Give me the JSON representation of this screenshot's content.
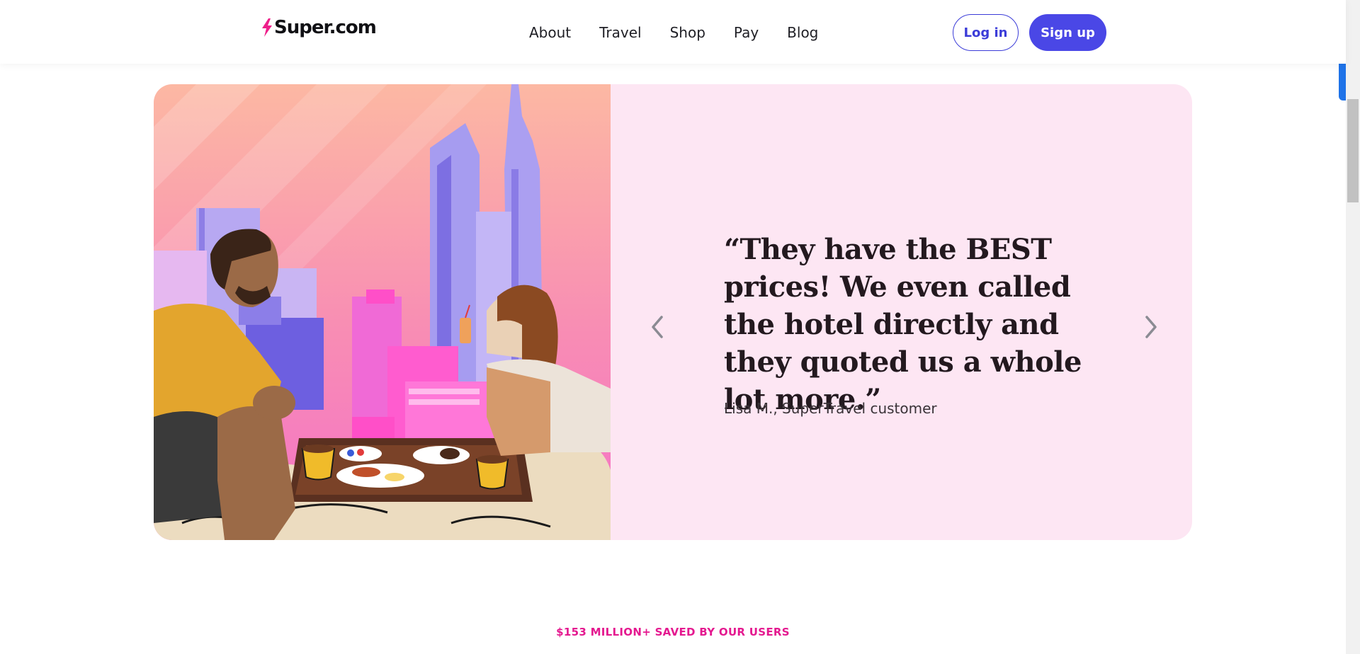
{
  "header": {
    "logo_text": "Super.com",
    "nav": [
      "About",
      "Travel",
      "Shop",
      "Pay",
      "Blog"
    ],
    "login_label": "Log in",
    "signup_label": "Sign up"
  },
  "testimonial": {
    "quote": "“They have the BEST prices! We even called the hotel directly and they quoted us a whole lot more.”",
    "author": "Lisa M., SuperTravel customer",
    "prev_icon": "chevron-left-icon",
    "next_icon": "chevron-right-icon"
  },
  "stat": {
    "text": "$153 MILLION+ SAVED BY OUR USERS"
  },
  "colors": {
    "accent": "#4a47e6",
    "stat_pink": "#e4188f",
    "card_bg": "#fde6f3"
  }
}
